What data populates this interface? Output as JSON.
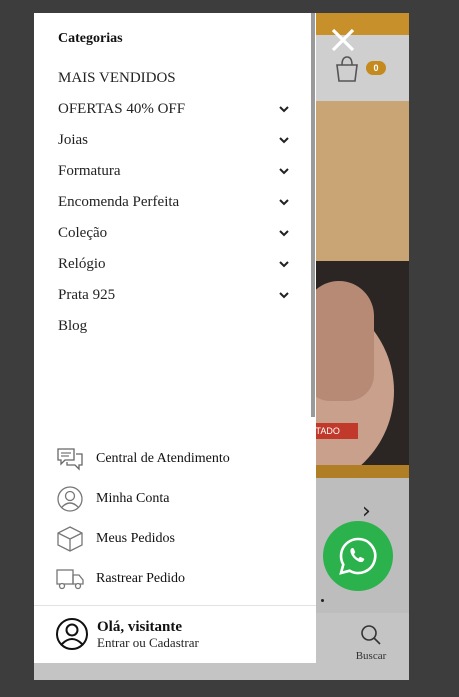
{
  "background_page": {
    "cart_badge": "0",
    "sale_tag": "...TADO",
    "nav_search_label": "Buscar",
    "colors": {
      "topbar": "#c8902a",
      "badge": "#c48a1e",
      "tag": "#c0392b"
    }
  },
  "drawer": {
    "categories_title": "Categorias",
    "menu": [
      {
        "label": "MAIS VENDIDOS",
        "has_submenu": false
      },
      {
        "label": "OFERTAS 40% OFF",
        "has_submenu": true
      },
      {
        "label": "Joias",
        "has_submenu": true
      },
      {
        "label": "Formatura",
        "has_submenu": true
      },
      {
        "label": "Encomenda Perfeita",
        "has_submenu": true
      },
      {
        "label": "Coleção",
        "has_submenu": true
      },
      {
        "label": "Relógio",
        "has_submenu": true
      },
      {
        "label": "Prata 925",
        "has_submenu": true
      },
      {
        "label": "Blog",
        "has_submenu": false
      }
    ],
    "service_links": [
      {
        "label": "Central de Atendimento",
        "icon": "chat-bubbles-icon"
      },
      {
        "label": "Minha Conta",
        "icon": "user-circle-icon"
      },
      {
        "label": "Meus Pedidos",
        "icon": "package-box-icon"
      },
      {
        "label": "Rastrear Pedido",
        "icon": "truck-icon"
      }
    ],
    "footer": {
      "greeting": "Olá, visitante",
      "login_link": "Entrar ou Cadastrar",
      "icon": "user-circle-icon"
    }
  },
  "controls": {
    "close_icon": "close-icon",
    "whatsapp_icon": "whatsapp-icon",
    "whatsapp_color": "#2bb24c"
  }
}
